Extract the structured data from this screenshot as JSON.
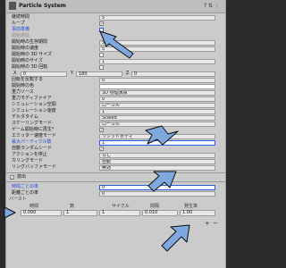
{
  "header": {
    "title": "Particle System",
    "tools": "? ⇅ ⋮"
  },
  "rows": {
    "duration": {
      "label": "継続時間",
      "value": "5"
    },
    "looping": {
      "label": "ループ",
      "checked": "✓"
    },
    "prewarm": {
      "label": "事前準備"
    },
    "start_delay": {
      "label": "開始遅延"
    },
    "start_lifetime": {
      "label": "開始時の生存期間",
      "value": "5"
    },
    "start_speed": {
      "label": "開始時の速度",
      "value": "5"
    },
    "start_size_3d": {
      "label": "開始時の 3D サイズ"
    },
    "start_size": {
      "label": "開始時のサイズ",
      "value": "1"
    },
    "start_rotation_3d": {
      "label": "開始時の 3D 回転"
    },
    "xyz": {
      "x_label": "X",
      "x": "0",
      "y_label": "Y",
      "y": "180",
      "z_label": "Z",
      "z": "0"
    },
    "flip_rotation": {
      "label": "回転を反転する",
      "value": "0"
    },
    "start_color": {
      "label": "開始時の色"
    },
    "gravity_source": {
      "label": "重力ソース",
      "value": "3D 物理演算"
    },
    "gravity_modifier": {
      "label": "重力モディファイア",
      "value": "0"
    },
    "simulation_space": {
      "label": "シミュレーション空間",
      "value": "ローカル"
    },
    "simulation_speed": {
      "label": "シミュレーション速度",
      "value": "1"
    },
    "delta_time": {
      "label": "デルタタイム",
      "value": "Scaled"
    },
    "scaling_mode": {
      "label": "スケーリングモード",
      "value": "ローカル"
    },
    "play_on_awake": {
      "label": "ゲーム開始時に再生*",
      "checked": "✓"
    },
    "emitter_velocity": {
      "label": "エミッター速度モード",
      "value": "リジッドボディ"
    },
    "max_particles": {
      "label": "最大パーティクル数",
      "value": "1"
    },
    "auto_random_seed": {
      "label": "自動ランダムシード",
      "checked": "✓"
    },
    "stop_action": {
      "label": "アクションを停止",
      "value": "なし"
    },
    "culling_mode": {
      "label": "カリングモード",
      "value": "自動"
    },
    "ring_buffer": {
      "label": "リングバッファモード",
      "value": "無効"
    }
  },
  "emission": {
    "title": "放出",
    "rate_time": {
      "label": "時間ごとの率",
      "value": "0"
    },
    "rate_distance": {
      "label": "距離ごとの率",
      "value": "0"
    },
    "bursts_label": "バースト",
    "headers": [
      "時間",
      "数",
      "サイクル",
      "間隔",
      "発生率"
    ],
    "row": [
      "0.000",
      "1",
      "1",
      "0.010",
      "1.00"
    ],
    "plus": "+",
    "minus": "−"
  },
  "accent_color": "#2d5fd0",
  "arrow_color": "#7fa8df"
}
